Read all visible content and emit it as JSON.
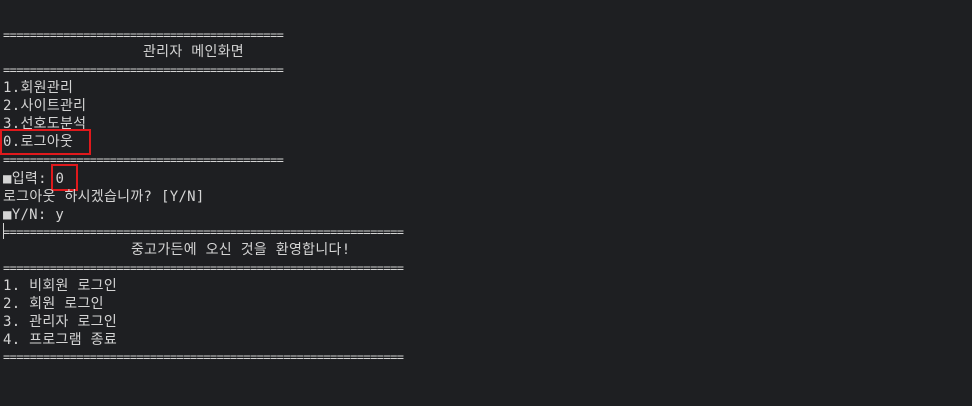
{
  "admin_menu": {
    "rule_top": "==========================================",
    "title": "관리자 메인화면",
    "rule_mid": "==========================================",
    "items": [
      "1.회원관리",
      "2.사이트관리",
      "3.선호도분석",
      "0.로그아웃"
    ],
    "rule_bottom": "=========================================="
  },
  "input_prompt": {
    "label": "■입력: ",
    "value": "0"
  },
  "confirm": {
    "question": "로그아웃 하시겠습니까? [Y/N]",
    "yn_label": "■Y/N: ",
    "yn_value": "y"
  },
  "main_menu": {
    "rule_top": "============================================================",
    "title": "중고가든에 오신 것을 환영합니다!",
    "rule_mid": "============================================================",
    "items": [
      "1. 비회원 로그인",
      "2. 회원 로그인",
      "3. 관리자 로그인",
      "4. 프로그램 종료"
    ],
    "rule_bottom": "============================================================"
  },
  "highlight_color": "#e0191c"
}
